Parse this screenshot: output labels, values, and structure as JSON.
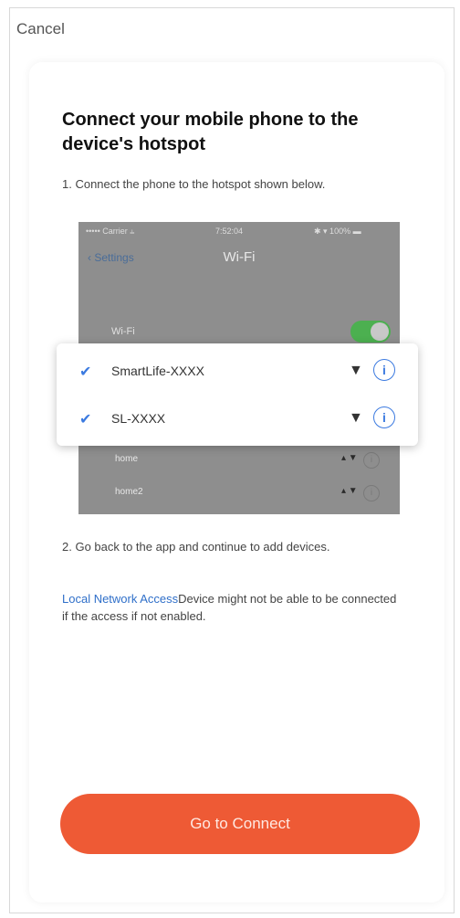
{
  "header": {
    "cancel_label": "Cancel"
  },
  "title": "Connect your mobile phone to the device's hotspot",
  "step1": "1. Connect the phone to the hotspot shown below.",
  "phone": {
    "status_carrier": "••••• Carrier ⫨",
    "status_time": "7:52:04",
    "status_battery": "✱ ▾ 100% ▬",
    "back_label": "‹ Settings",
    "nav_title": "Wi-Fi",
    "wifi_label": "Wi-Fi",
    "wifi_on": true,
    "other_networks": [
      {
        "name": "home",
        "signal": "▴ ▼",
        "info": "i"
      },
      {
        "name": "home2",
        "signal": "▴ ▼",
        "info": "i"
      }
    ]
  },
  "hotspots": [
    {
      "name": "SmartLife-XXXX",
      "check": "✔",
      "signal": "▼",
      "info": "i"
    },
    {
      "name": "SL-XXXX",
      "check": "✔",
      "signal": "▼",
      "info": "i"
    }
  ],
  "step2": "2. Go back to the app and continue to add devices.",
  "note": {
    "link": "Local Network Access",
    "text": "Device might not be able to be connected if the access if not enabled."
  },
  "connect_button": "Go to Connect",
  "colors": {
    "accent": "#ee5a35",
    "link": "#2f6fc9",
    "check": "#3b7ae0",
    "toggle_on": "#4cb050"
  }
}
